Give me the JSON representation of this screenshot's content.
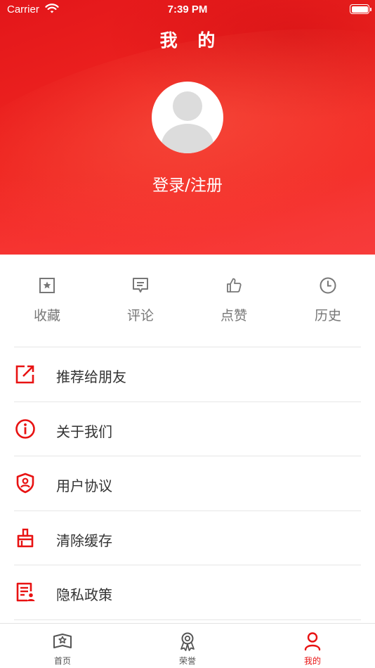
{
  "status_bar": {
    "carrier": "Carrier",
    "time": "7:39 PM"
  },
  "header": {
    "title": "我 的",
    "login_text": "登录/注册"
  },
  "quick_actions": [
    {
      "label": "收藏",
      "icon": "star-bookmark-icon"
    },
    {
      "label": "评论",
      "icon": "comment-icon"
    },
    {
      "label": "点赞",
      "icon": "thumbs-up-icon"
    },
    {
      "label": "历史",
      "icon": "clock-icon"
    }
  ],
  "menu": [
    {
      "label": "推荐给朋友",
      "icon": "share-external-icon"
    },
    {
      "label": "关于我们",
      "icon": "info-icon"
    },
    {
      "label": "用户协议",
      "icon": "shield-user-icon"
    },
    {
      "label": "清除缓存",
      "icon": "broom-icon"
    },
    {
      "label": "隐私政策",
      "icon": "privacy-document-icon"
    }
  ],
  "tabbar": [
    {
      "label": "首页",
      "icon": "home-book-icon",
      "active": false
    },
    {
      "label": "荣誉",
      "icon": "medal-icon",
      "active": false
    },
    {
      "label": "我的",
      "icon": "person-icon",
      "active": true
    }
  ],
  "colors": {
    "accent": "#e81212",
    "header_red": "#ee2420",
    "muted_text": "#777777"
  }
}
